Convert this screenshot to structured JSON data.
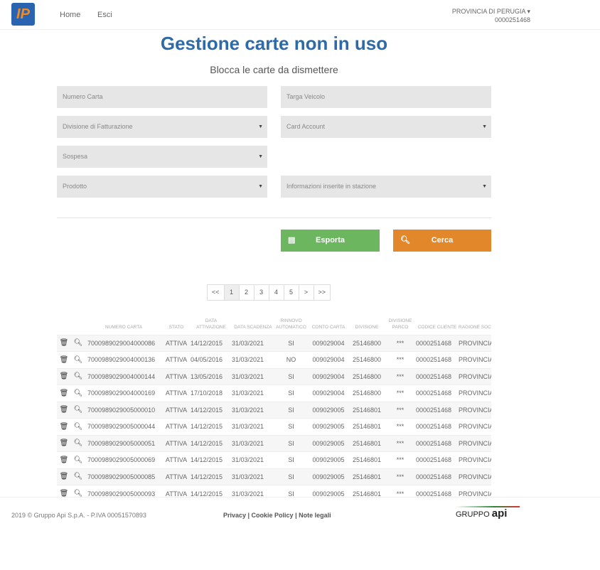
{
  "nav": {
    "logo": "IP",
    "links": [
      "Home",
      "Esci"
    ],
    "user": "PROVINCIA DI PERUGIA",
    "user_code": "0000251468"
  },
  "title": "Gestione carte non in uso",
  "subtitle": "Blocca le carte da dismettere",
  "form": {
    "numero_carta": "Numero Carta",
    "targa": "Targa Veicolo",
    "divisione": "Divisione di Fatturazione",
    "card_account": "Card Account",
    "sospesa": "Sospesa",
    "prodotto": "Prodotto",
    "info": "Informazioni inserite in stazione"
  },
  "buttons": {
    "export": "Esporta",
    "search": "Cerca",
    "export_color": "#6bb65f",
    "search_color": "#e2872a"
  },
  "pagination": [
    "<<",
    "1",
    "2",
    "3",
    "4",
    "5",
    ">",
    ">>"
  ],
  "table": {
    "headers": [
      "NUMERO CARTA",
      "STATO",
      "DATA ATTIVAZIONE",
      "DATA SCADENZA",
      "RINNOVO AUTOMATICO",
      "CONTO CARTA",
      "DIVISIONE",
      "DIVISIONE PARCO",
      "CODICE CLIENTE",
      "RAGIONE SOCIALE CLIENTE"
    ],
    "rows": [
      [
        "7000989029004000086",
        "ATTIVA",
        "14/12/2015",
        "31/03/2021",
        "SI",
        "009029004",
        "25146800",
        "***",
        "0000251468",
        "PROVINCIA"
      ],
      [
        "7000989029004000136",
        "ATTIVA",
        "04/05/2016",
        "31/03/2021",
        "NO",
        "009029004",
        "25146800",
        "***",
        "0000251468",
        "PROVINCIA"
      ],
      [
        "7000989029004000144",
        "ATTIVA",
        "13/05/2016",
        "31/03/2021",
        "SI",
        "009029004",
        "25146800",
        "***",
        "0000251468",
        "PROVINCIA"
      ],
      [
        "7000989029004000169",
        "ATTIVA",
        "17/10/2018",
        "31/03/2021",
        "SI",
        "009029004",
        "25146800",
        "***",
        "0000251468",
        "PROVINCIA"
      ],
      [
        "7000989029005000010",
        "ATTIVA",
        "14/12/2015",
        "31/03/2021",
        "SI",
        "009029005",
        "25146801",
        "***",
        "0000251468",
        "PROVINCIA"
      ],
      [
        "7000989029005000044",
        "ATTIVA",
        "14/12/2015",
        "31/03/2021",
        "SI",
        "009029005",
        "25146801",
        "***",
        "0000251468",
        "PROVINCIA"
      ],
      [
        "7000989029005000051",
        "ATTIVA",
        "14/12/2015",
        "31/03/2021",
        "SI",
        "009029005",
        "25146801",
        "***",
        "0000251468",
        "PROVINCIA"
      ],
      [
        "7000989029005000069",
        "ATTIVA",
        "14/12/2015",
        "31/03/2021",
        "SI",
        "009029005",
        "25146801",
        "***",
        "0000251468",
        "PROVINCIA"
      ],
      [
        "7000989029005000085",
        "ATTIVA",
        "14/12/2015",
        "31/03/2021",
        "SI",
        "009029005",
        "25146801",
        "***",
        "0000251468",
        "PROVINCIA"
      ],
      [
        "7000989029005000093",
        "ATTIVA",
        "14/12/2015",
        "31/03/2021",
        "SI",
        "009029005",
        "25146801",
        "***",
        "0000251468",
        "PROVINCIA"
      ]
    ]
  },
  "footer": {
    "copyright": "2019 © Gruppo Api S.p.A. - P.IVA 00051570893",
    "links": "Privacy | Cookie Policy | Note legali",
    "brand": "GRUPPO",
    "brand_bold": "api"
  }
}
